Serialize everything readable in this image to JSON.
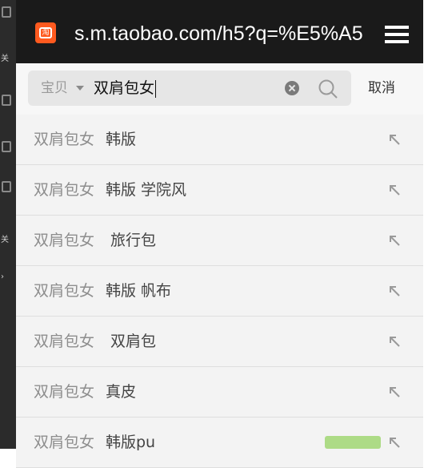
{
  "browser": {
    "url": "s.m.taobao.com/h5?q=%E5%A5"
  },
  "search": {
    "scope_label": "宝贝",
    "query": "双肩包女",
    "cancel_label": "取消"
  },
  "suggestions": [
    {
      "prefix": "双肩包女",
      "suffix": "韩版"
    },
    {
      "prefix": "双肩包女",
      "suffix": "韩版 学院风"
    },
    {
      "prefix": "双肩包女",
      "suffix": " 旅行包"
    },
    {
      "prefix": "双肩包女",
      "suffix": "韩版 帆布"
    },
    {
      "prefix": "双肩包女",
      "suffix": " 双肩包"
    },
    {
      "prefix": "双肩包女",
      "suffix": "真皮"
    },
    {
      "prefix": "双肩包女",
      "suffix": "韩版pu"
    }
  ],
  "colors": {
    "address_bar_bg": "#1a1a1a",
    "favicon": "#ff5a1f",
    "list_bg": "#f3f3f3"
  }
}
